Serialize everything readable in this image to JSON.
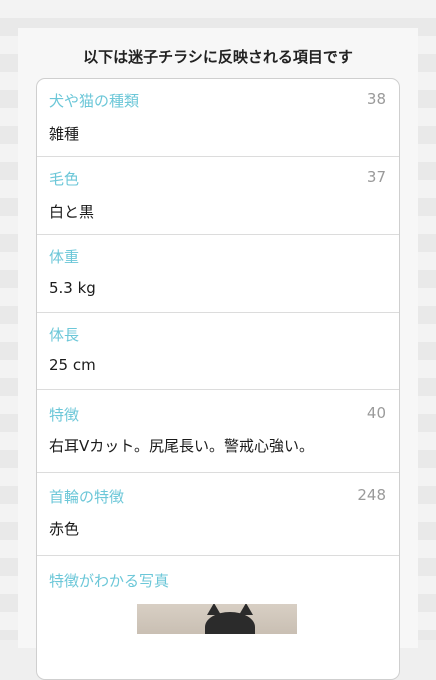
{
  "title": "以下は迷子チラシに反映される項目です",
  "fields": [
    {
      "label": "犬や猫の種類",
      "count": "38",
      "value": "雑種"
    },
    {
      "label": "毛色",
      "count": "37",
      "value": "白と黒"
    },
    {
      "label": "体重",
      "count": "",
      "value": "5.3 kg"
    },
    {
      "label": "体長",
      "count": "",
      "value": "25 cm"
    },
    {
      "label": "特徴",
      "count": "40",
      "value": "右耳Vカット。尻尾長い。警戒心強い。"
    },
    {
      "label": "首輪の特徴",
      "count": "248",
      "value": "赤色"
    },
    {
      "label": "特徴がわかる写真",
      "count": "",
      "value": ""
    }
  ],
  "colors": {
    "label": "#6cc7d8",
    "count": "#9a9a9a",
    "value": "#1b1b1b"
  },
  "icons": {
    "photo": "cat-photo-thumbnail"
  }
}
